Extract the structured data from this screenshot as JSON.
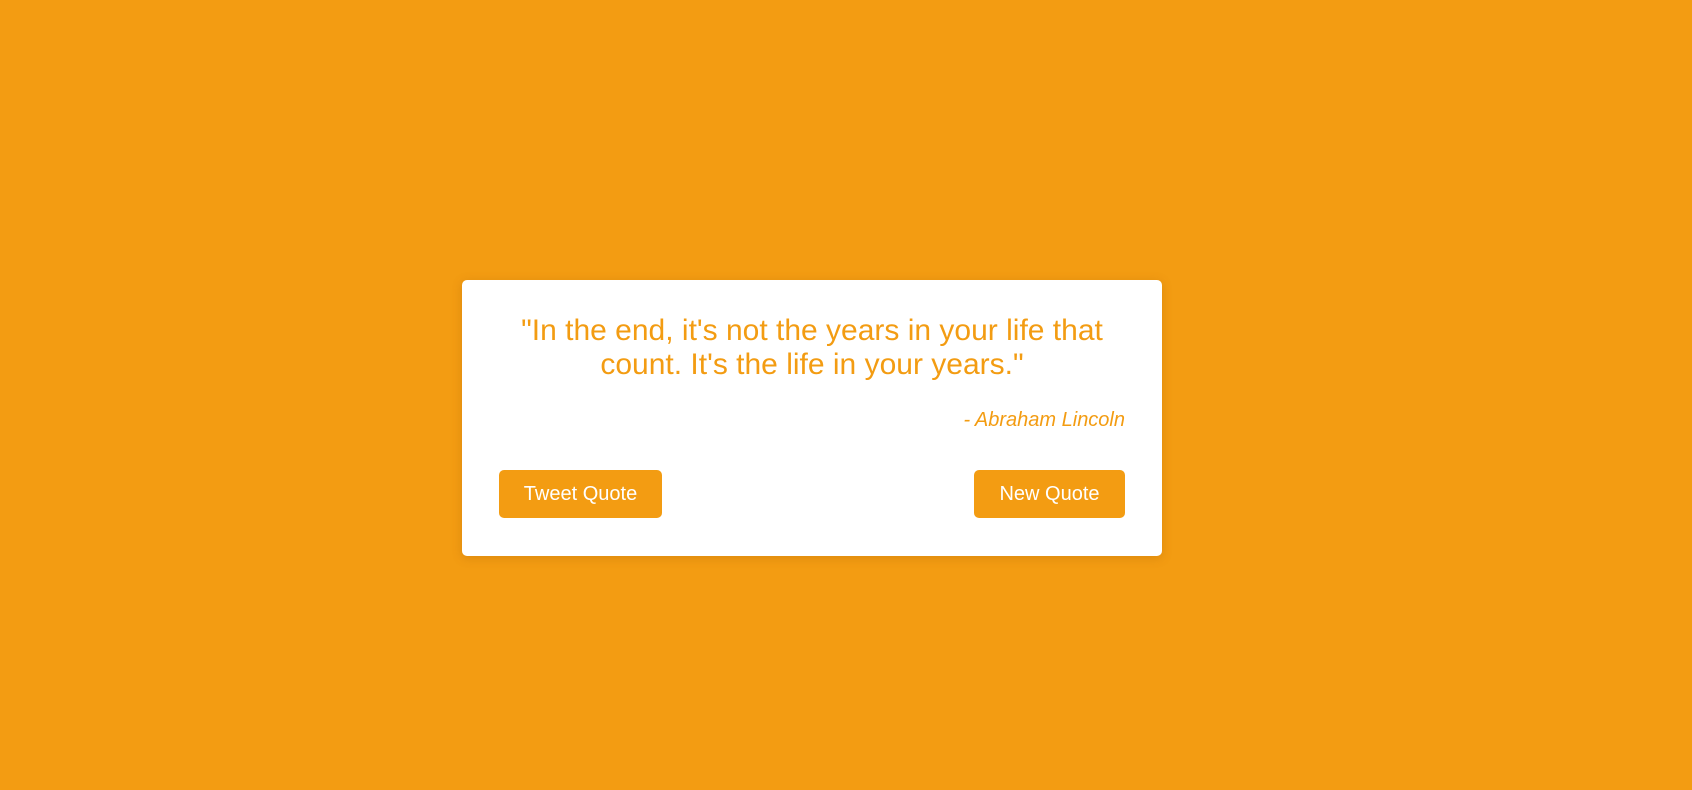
{
  "theme": {
    "background": "#f39c12",
    "card_background": "#ffffff",
    "accent": "#f39c12"
  },
  "quote_box": {
    "text": "\"In the end, it's not the years in your life that count. It's the life in your years.\"",
    "author": "- Abraham Lincoln"
  },
  "actions": {
    "tweet_label": "Tweet Quote",
    "new_label": "New Quote"
  }
}
